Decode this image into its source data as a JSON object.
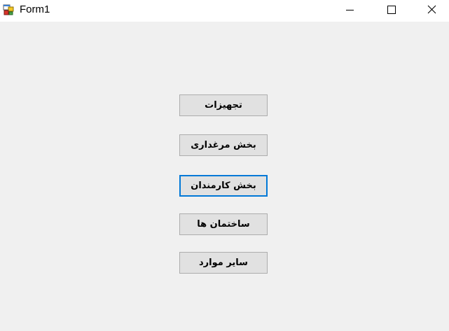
{
  "window": {
    "title": "Form1",
    "icon": "winforms-app-icon"
  },
  "title_buttons": {
    "minimize_icon": "minimize-icon",
    "maximize_icon": "maximize-icon",
    "close_icon": "close-icon"
  },
  "buttons": [
    {
      "label": "تجهیزات"
    },
    {
      "label": "بخش مرغداری"
    },
    {
      "label": "بخش کارمندان",
      "focused": true
    },
    {
      "label": "ساختمان ها"
    },
    {
      "label": "سایر موارد"
    }
  ],
  "colors": {
    "background": "#f0f0f0",
    "titlebar": "#ffffff",
    "button_face": "#e1e1e1",
    "button_border": "#adadad",
    "focus_border": "#0078d7"
  }
}
